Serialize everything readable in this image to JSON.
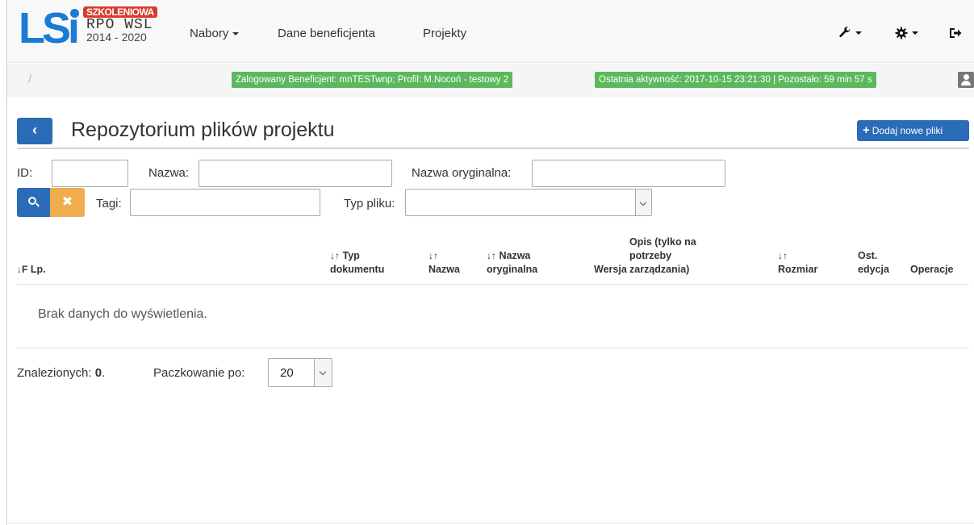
{
  "logo": {
    "lsi": "LSi",
    "tag": "SZKOLENIOWA",
    "program": "RPO WSL",
    "years": "2014 - 2020"
  },
  "nav": {
    "nabory": "Nabory",
    "dane": "Dane beneficjenta",
    "projekty": "Projekty",
    "icons": [
      "wrench-icon",
      "cog-icon",
      "logout-icon"
    ]
  },
  "status": {
    "breadcrumb": "/",
    "logged": "Zalogowany Beneficjent: mnTESTwnp; Profil: M.Nocoń - testowy 2",
    "activity": "Ostatnia aktywność: 2017-10-15 23:21:30 | Pozostało: 59 min 57 s",
    "badge_color": "#5cb85c"
  },
  "header": {
    "back_glyph": "‹",
    "title": "Repozytorium plików projektu",
    "add_label": "Dodaj nowe pliki",
    "accent": "#2b6cb8"
  },
  "filters": {
    "id_label": "ID:",
    "nazwa_label": "Nazwa:",
    "oryg_label": "Nazwa oryginalna:",
    "tagi_label": "Tagi:",
    "typ_label": "Typ pliku:",
    "clear_glyph": "✖"
  },
  "table": {
    "lp": {
      "icon": "↓F",
      "label": "Lp."
    },
    "typ": {
      "icon": "↓↑",
      "line1": "Typ",
      "line2": "dokumentu"
    },
    "nazwa": {
      "icon": "↓↑",
      "line2": "Nazwa"
    },
    "oryg": {
      "icon": "↓↑",
      "line1": "Nazwa",
      "line2": "oryginalna"
    },
    "wersja": "Wersja",
    "opis": {
      "line1": "Opis (tylko na",
      "line2": "potrzeby",
      "line3": "zarządzania)"
    },
    "rozmiar": {
      "icon": "↓↑",
      "line2": "Rozmiar"
    },
    "ost": {
      "line1": "Ost.",
      "line2": "edycja"
    },
    "operacje": "Operacje",
    "empty": "Brak danych do wyświetlenia."
  },
  "footer": {
    "found_label": "Znalezionych:",
    "found_count": "0",
    "found_dot": ".",
    "page_label": "Paczkowanie po:",
    "page_size": "20"
  }
}
